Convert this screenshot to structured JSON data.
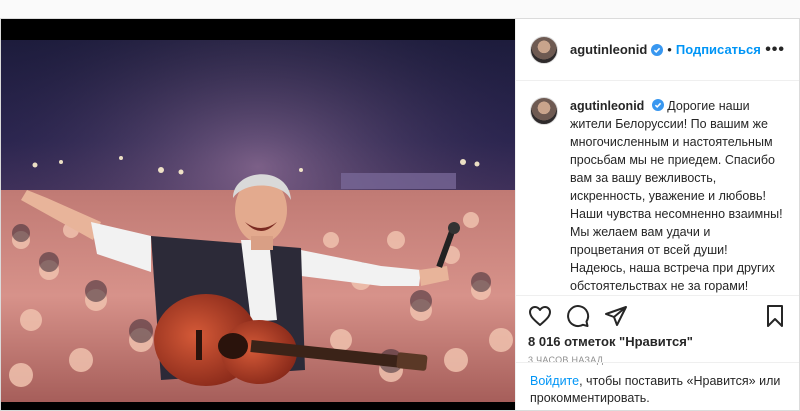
{
  "post": {
    "username": "agutinleonid",
    "follow_label": "Подписаться",
    "separator": "•",
    "more_label": "•••",
    "caption": "Дорогие наши жители Белоруссии! По вашим же многочисленным и настоятельным просьбам мы не приедем. Спасибо вам за вашу вежливость, искренность, уважение и любовь! Наши чувства несомненно взаимны! Мы желаем вам удачи и процветания от всей души! Надеюсь, наша встреча при других обстоятельствах не за горами!",
    "likes": "8 016 отметок \"Нравится\"",
    "timestamp": "3 ЧАСОВ НАЗАД",
    "login_link": "Войдите",
    "login_rest": ", чтобы поставить «Нравится» или прокомментировать."
  },
  "icons": {
    "verified": "verified-badge-icon",
    "like": "heart-icon",
    "comment": "comment-icon",
    "share": "share-icon",
    "save": "bookmark-icon",
    "more": "more-options-icon"
  },
  "colors": {
    "link": "#0095f6",
    "text": "#262626",
    "muted": "#8e8e8e",
    "border": "#dbdbdb"
  }
}
